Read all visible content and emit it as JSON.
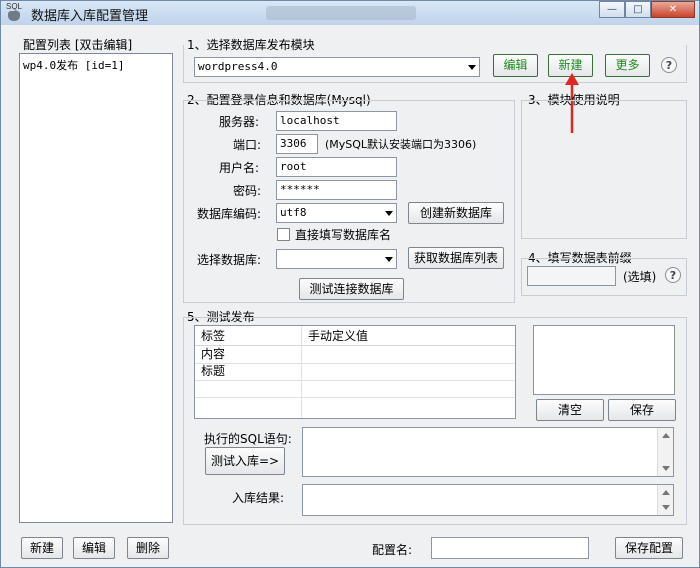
{
  "window": {
    "title": "数据库入库配置管理",
    "app_icon_text": "SQL",
    "controls": {
      "minimize": "—",
      "maximize": "□",
      "close": "✕"
    }
  },
  "config_list": {
    "header": "配置列表  [双击编辑]",
    "items": [
      "wp4.0发布 [id=1]"
    ]
  },
  "section1": {
    "title": "1、选择数据库发布模块",
    "selected_module": "wordpress4.0",
    "edit_label": "编辑",
    "new_label": "新建",
    "more_label": "更多",
    "help": "?"
  },
  "section2": {
    "title": "2、配置登录信息和数据库(Mysql)",
    "server_label": "服务器:",
    "server_value": "localhost",
    "port_label": "端口:",
    "port_value": "3306",
    "port_hint": "(MySQL默认安装端口为3306)",
    "username_label": "用户名:",
    "username_value": "root",
    "password_label": "密码:",
    "password_value": "******",
    "encoding_label": "数据库编码:",
    "encoding_value": "utf8",
    "create_db_label": "创建新数据库",
    "direct_input_label": "直接填写数据库名",
    "select_db_label": "选择数据库:",
    "select_db_value": "",
    "fetch_list_label": "获取数据库列表",
    "test_connect_label": "测试连接数据库"
  },
  "section3": {
    "title": "3、模块使用说明"
  },
  "section4": {
    "title": "4、填写数据表前缀",
    "prefix_value": "",
    "optional_label": "(选填)",
    "help": "?"
  },
  "section5": {
    "title": "5、测试发布",
    "columns": [
      "标签",
      "手动定义值"
    ],
    "rows": [
      {
        "tag": "内容",
        "value": ""
      },
      {
        "tag": "标题",
        "value": ""
      }
    ],
    "clear_label": "清空",
    "save_label": "保存",
    "sql_label": "执行的SQL语句:",
    "test_insert_label": "测试入库=>",
    "result_label": "入库结果:"
  },
  "footer": {
    "new_label": "新建",
    "edit_label": "编辑",
    "delete_label": "删除",
    "config_name_label": "配置名:",
    "config_name_value": "",
    "save_config_label": "保存配置"
  }
}
